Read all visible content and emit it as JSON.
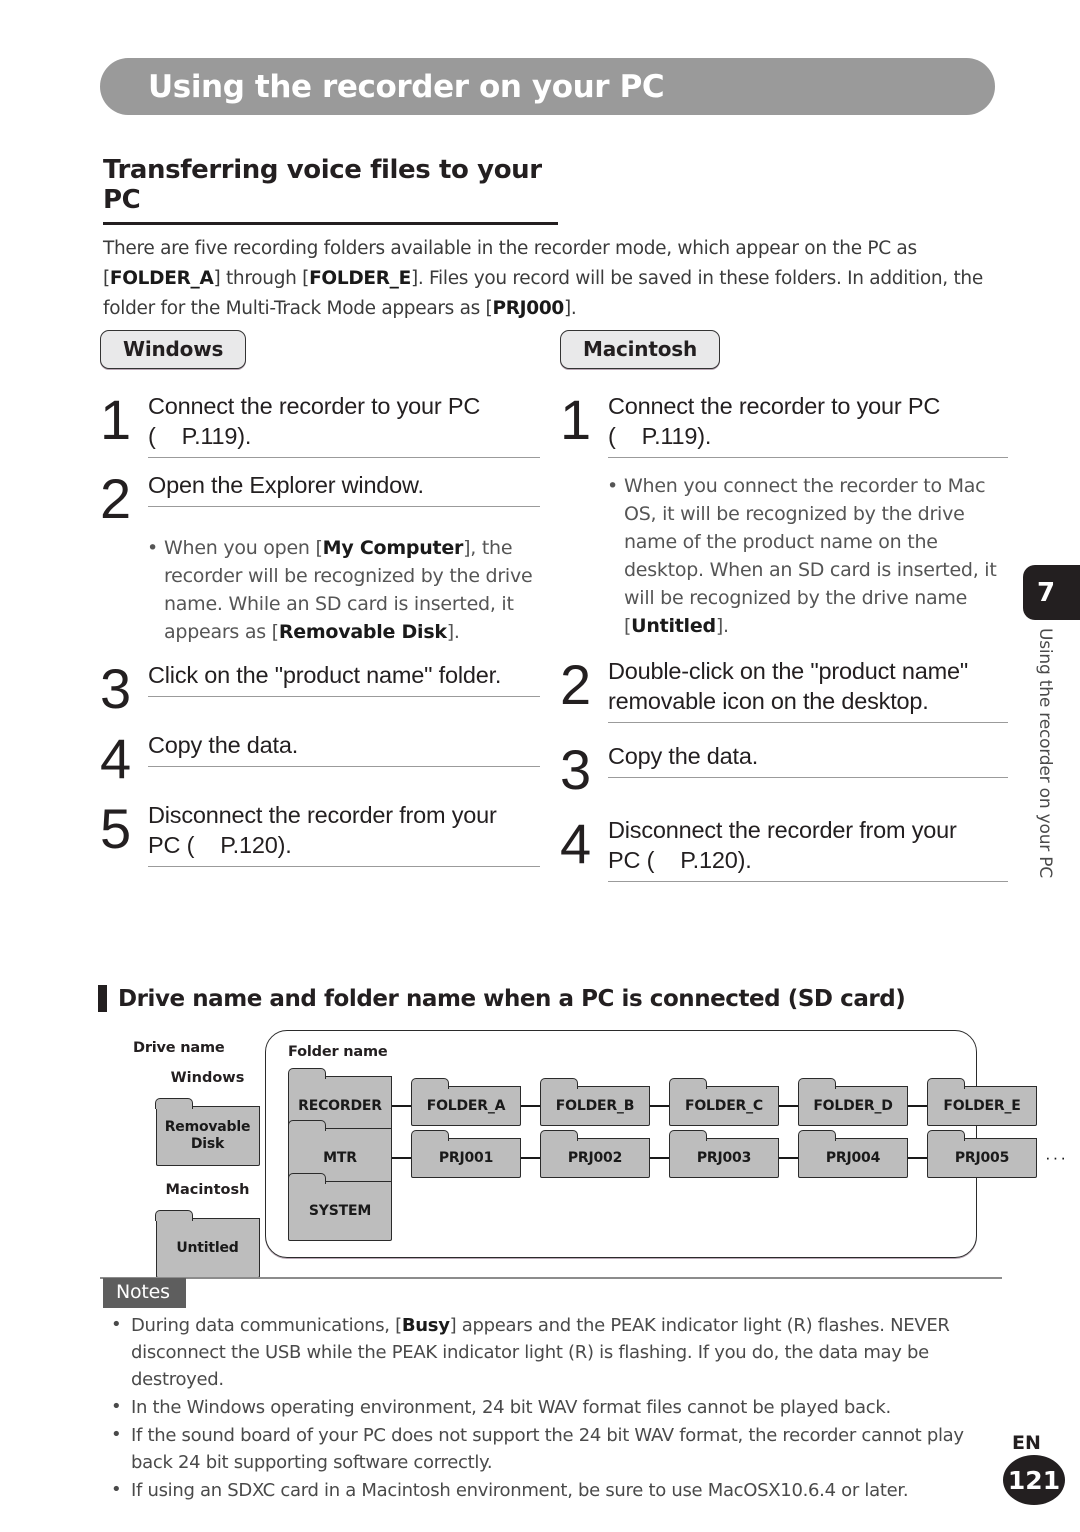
{
  "header": {
    "title": "Using the recorder on your PC"
  },
  "section": {
    "title": "Transferring voice files to your PC",
    "intro_part1": "There are five recording folders available in the recorder mode, which appear on the PC as [",
    "intro_bold1": "FOLDER_A",
    "intro_part2": "] through [",
    "intro_bold2": "FOLDER_E",
    "intro_part3": "]. Files you record will be saved in these folders. In addition, the folder for the Multi-Track Mode appears as [",
    "intro_bold3": "PRJ000",
    "intro_part4": "]."
  },
  "windows": {
    "badge": "Windows",
    "steps": [
      {
        "num": "1",
        "line1": "Connect the recorder to your PC",
        "line2a": "(",
        "line2b": "P.119)."
      },
      {
        "num": "2",
        "line1": "Open the Explorer window."
      },
      {
        "num": "3",
        "line1": "Click on the \"product name\" folder."
      },
      {
        "num": "4",
        "line1": "Copy the data."
      },
      {
        "num": "5",
        "line1": "Disconnect the recorder from your",
        "line2a": "PC (",
        "line2b": "P.120)."
      }
    ],
    "note": {
      "part1": "When you open [",
      "bold1": "My Computer",
      "part2": "], the recorder will be recognized by the drive name. While an SD card is inserted, it appears as [",
      "bold2": "Removable Disk",
      "part3": "]."
    }
  },
  "macintosh": {
    "badge": "Macintosh",
    "steps": [
      {
        "num": "1",
        "line1": "Connect the recorder to your PC",
        "line2a": "(",
        "line2b": "P.119)."
      },
      {
        "num": "2",
        "line1": "Double-click on the \"product name\" removable icon on the desktop."
      },
      {
        "num": "3",
        "line1": "Copy the data."
      },
      {
        "num": "4",
        "line1": "Disconnect the recorder from your",
        "line2a": "PC (",
        "line2b": "P.120)."
      }
    ],
    "note": {
      "part1": "When you connect the recorder to Mac OS, it will be recognized by the drive name of the product name on the desktop. When an SD card is inserted, it will be recognized by the drive name [",
      "bold1": "Untitled",
      "part2": "]."
    }
  },
  "side_tab": {
    "chapter": "7",
    "vertical_label": "Using the recorder on your PC"
  },
  "subheading": {
    "text": "Drive name and folder name when a PC is connected (SD card)"
  },
  "diagram": {
    "drive_name_label": "Drive name",
    "folder_name_label": "Folder name",
    "windows_label": "Windows",
    "windows_drive": "Removable Disk",
    "macintosh_label": "Macintosh",
    "macintosh_drive": "Untitled",
    "row1_root": "RECORDER",
    "row1_children": [
      "FOLDER_A",
      "FOLDER_B",
      "FOLDER_C",
      "FOLDER_D",
      "FOLDER_E"
    ],
    "row2_root": "MTR",
    "row2_children": [
      "PRJ001",
      "PRJ002",
      "PRJ003",
      "PRJ004",
      "PRJ005"
    ],
    "row2_ellipsis": "···",
    "row3_root": "SYSTEM"
  },
  "notes": {
    "badge": "Notes",
    "items": [
      {
        "part1": "During data communications, [",
        "bold1": "Busy",
        "part2": "] appears and the PEAK indicator light (R) flashes. NEVER disconnect the USB while the  PEAK indicator light (R) is flashing. If you do, the data may be destroyed."
      },
      {
        "part1": "In the Windows operating environment, 24 bit WAV format files cannot be played back."
      },
      {
        "part1": "If the sound board of your PC does not support the 24 bit WAV format, the recorder cannot play back 24 bit supporting software correctly."
      },
      {
        "part1": "If using an SDXC card in a Macintosh environment, be sure to use MacOSX10.6.4 or later."
      }
    ]
  },
  "footer": {
    "language": "EN",
    "page": "121"
  },
  "colors": {
    "header_bar": "#9a9a9a",
    "tab": "#231f20",
    "folder_fill": "#bdbdbd",
    "notes_badge": "#5e5e5e"
  }
}
